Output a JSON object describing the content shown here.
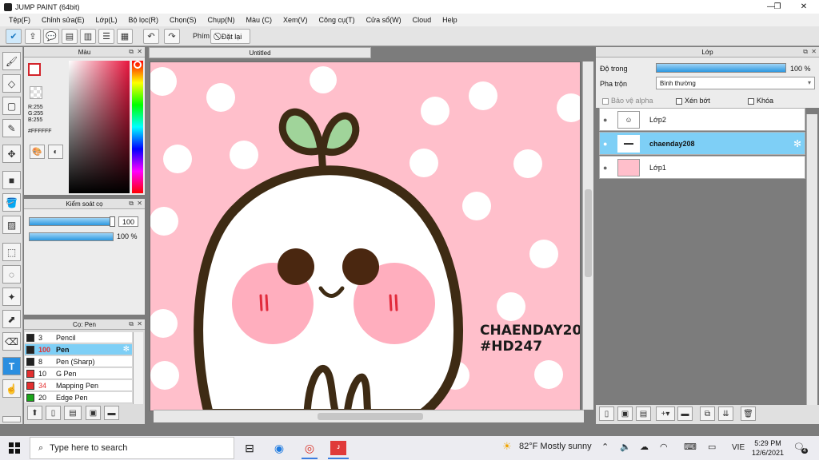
{
  "app": {
    "title": "JUMP PAINT (64bit)"
  },
  "menu": [
    "Tệp(F)",
    "Chỉnh sửa(E)",
    "Lớp(L)",
    "Bộ lọc(R)",
    "Chọn(S)",
    "Chụp(N)",
    "Màu (C)",
    "Xem(V)",
    "Công cụ(T)",
    "Cửa sổ(W)",
    "Cloud",
    "Help"
  ],
  "toolbar": {
    "shortcut_label": "Phím",
    "reset_label": "Đặt lại"
  },
  "color_panel": {
    "title": "Màu",
    "r": "R:255",
    "g": "G:255",
    "b": "B:255",
    "hex": "#FFFFFF"
  },
  "brush_control": {
    "title": "Kiểm soát cọ",
    "size": "100",
    "opacity": "100 %"
  },
  "brush_panel": {
    "title": "Cọ: Pen",
    "items": [
      {
        "size": "3",
        "name": "Pencil",
        "color": "#222222"
      },
      {
        "size": "100",
        "name": "Pen",
        "color": "#222222"
      },
      {
        "size": "8",
        "name": "Pen (Sharp)",
        "color": "#222222"
      },
      {
        "size": "10",
        "name": "G Pen",
        "color": "#e32f2f"
      },
      {
        "size": "34",
        "name": "Mapping Pen",
        "color": "#e32f2f"
      },
      {
        "size": "20",
        "name": "Edge Pen",
        "color": "#1aa51a"
      }
    ]
  },
  "canvas": {
    "tab": "Untitled",
    "text_line1": "CHAENDAY208",
    "text_line2": "#HD247",
    "bg_color": "#ffbfcb"
  },
  "layer_panel": {
    "title": "Lớp",
    "opacity_label": "Độ trong",
    "opacity_value": "100 %",
    "blend_label": "Pha trộn",
    "blend_value": "Bình thường",
    "protect_alpha": "Bảo vệ alpha",
    "clipping": "Xén bớt",
    "lock": "Khóa",
    "layers": [
      {
        "name": "Lớp2",
        "selected": false
      },
      {
        "name": "chaenday208",
        "selected": true
      },
      {
        "name": "Lớp1",
        "selected": false
      }
    ]
  },
  "taskbar": {
    "search_placeholder": "Type here to search",
    "weather": "82°F  Mostly sunny",
    "lang": "VIE",
    "time": "5:29 PM",
    "date": "12/6/2021",
    "notif_count": "4"
  }
}
